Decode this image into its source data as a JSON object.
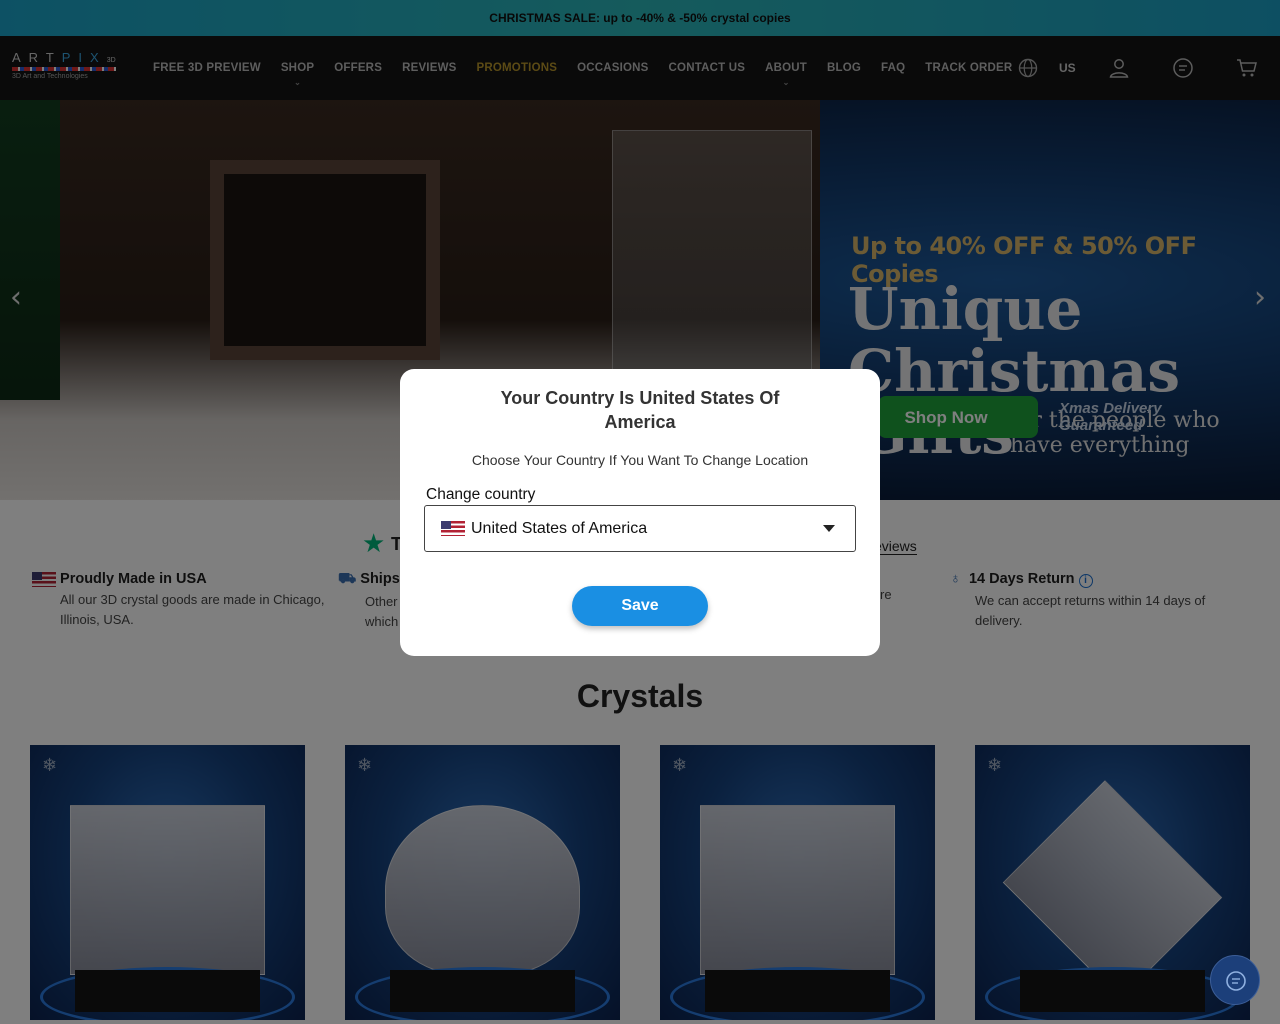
{
  "announcement": "CHRISTMAS SALE: up to -40% & -50% crystal copies",
  "logo": {
    "word_left": "ART",
    "word_right": "PIX",
    "suffix": "3D",
    "tagline": "3D Art and Technologies"
  },
  "nav": [
    {
      "label": "FREE 3D PREVIEW"
    },
    {
      "label": "SHOP",
      "has_dropdown": true
    },
    {
      "label": "OFFERS"
    },
    {
      "label": "REVIEWS"
    },
    {
      "label": "PROMOTIONS",
      "highlight": true
    },
    {
      "label": "OCCASIONS"
    },
    {
      "label": "CONTACT US"
    },
    {
      "label": "ABOUT",
      "has_dropdown": true
    },
    {
      "label": "BLOG"
    },
    {
      "label": "FAQ"
    },
    {
      "label": "TRACK ORDER"
    }
  ],
  "header_right": {
    "region": "US",
    "icons": [
      "globe-icon",
      "user-icon",
      "chat-icon",
      "cart-icon"
    ]
  },
  "hero": {
    "discount": "Up to 40% OFF & 50% OFF Copies",
    "line1": "Unique",
    "line2": "Christmas",
    "line3": "Gifts",
    "sub1": "for the people who",
    "sub2": "have everything",
    "cta": "Shop Now",
    "delivery1": "Xmas Delivery",
    "delivery2": "Guaranteed"
  },
  "trust_partial": "T",
  "reviews_link_partial": "eviews",
  "features": [
    {
      "title": "Proudly Made in USA",
      "desc1": "All our 3D crystal goods are made in Chicago,",
      "desc2": "Illinois, USA."
    },
    {
      "title": "Ships",
      "desc1": "Other",
      "desc2": "which"
    },
    {
      "title": "",
      "desc1": "re",
      "desc2": ""
    },
    {
      "title": "14 Days Return",
      "desc1": "We can accept returns within 14 days of",
      "desc2": "delivery."
    }
  ],
  "section_title": "Crystals",
  "modal": {
    "title_line1": "Your Country Is United States Of",
    "title_line2": "America",
    "subtitle": "Choose Your Country If You Want To Change Location",
    "label": "Change country",
    "selected_country": "United States of America",
    "save": "Save"
  },
  "colors": {
    "accent": "#1a8fe3",
    "promo": "#b9962b",
    "announce": "#2bb6b9",
    "header": "#141414"
  }
}
